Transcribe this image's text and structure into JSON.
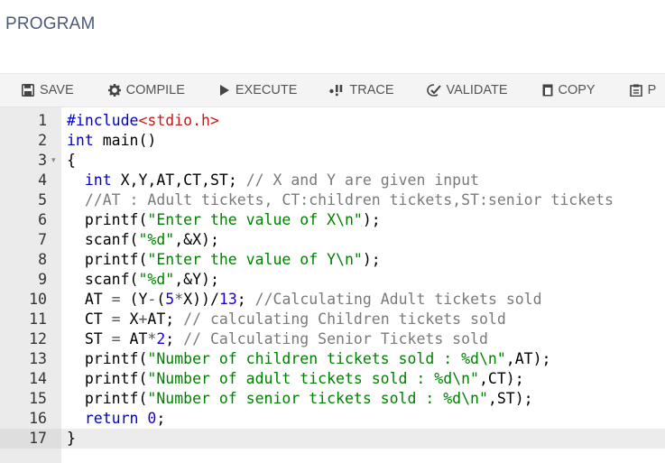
{
  "page": {
    "title": "PROGRAM"
  },
  "toolbar": {
    "buttons": [
      {
        "label": "SAVE",
        "icon": "save-icon"
      },
      {
        "label": "COMPILE",
        "icon": "gear-icon"
      },
      {
        "label": "EXECUTE",
        "icon": "play-icon"
      },
      {
        "label": "TRACE",
        "icon": "trace-icon"
      },
      {
        "label": "VALIDATE",
        "icon": "check-icon"
      },
      {
        "label": "COPY",
        "icon": "copy-icon"
      },
      {
        "label": "P",
        "icon": "paste-icon"
      }
    ]
  },
  "editor": {
    "language": "c",
    "active_line": 17,
    "lines": [
      {
        "n": "1",
        "fold": "",
        "text": "#include<stdio.h>"
      },
      {
        "n": "2",
        "fold": "",
        "text": "int main()"
      },
      {
        "n": "3",
        "fold": "▾",
        "text": "{"
      },
      {
        "n": "4",
        "fold": "",
        "text": "  int X,Y,AT,CT,ST; // X and Y are given input"
      },
      {
        "n": "5",
        "fold": "",
        "text": "  //AT : Adult tickets, CT:children tickets,ST:senior tickets"
      },
      {
        "n": "6",
        "fold": "",
        "text": "  printf(\"Enter the value of X\\n\");"
      },
      {
        "n": "7",
        "fold": "",
        "text": "  scanf(\"%d\",&X);"
      },
      {
        "n": "8",
        "fold": "",
        "text": "  printf(\"Enter the value of Y\\n\");"
      },
      {
        "n": "9",
        "fold": "",
        "text": "  scanf(\"%d\",&Y);"
      },
      {
        "n": "10",
        "fold": "",
        "text": "  AT = (Y-(5*X))/13; //Calculating Adult tickets sold"
      },
      {
        "n": "11",
        "fold": "",
        "text": "  CT = X+AT; // calculating Children tickets sold"
      },
      {
        "n": "12",
        "fold": "",
        "text": "  ST = AT*2; // Calculating Senior Tickets sold"
      },
      {
        "n": "13",
        "fold": "",
        "text": "  printf(\"Number of children tickets sold : %d\\n\",AT);"
      },
      {
        "n": "14",
        "fold": "",
        "text": "  printf(\"Number of adult tickets sold : %d\\n\",CT);"
      },
      {
        "n": "15",
        "fold": "",
        "text": "  printf(\"Number of senior tickets sold : %d\\n\",ST);"
      },
      {
        "n": "16",
        "fold": "",
        "text": "  return 0;"
      },
      {
        "n": "17",
        "fold": "",
        "text": "}"
      }
    ]
  }
}
